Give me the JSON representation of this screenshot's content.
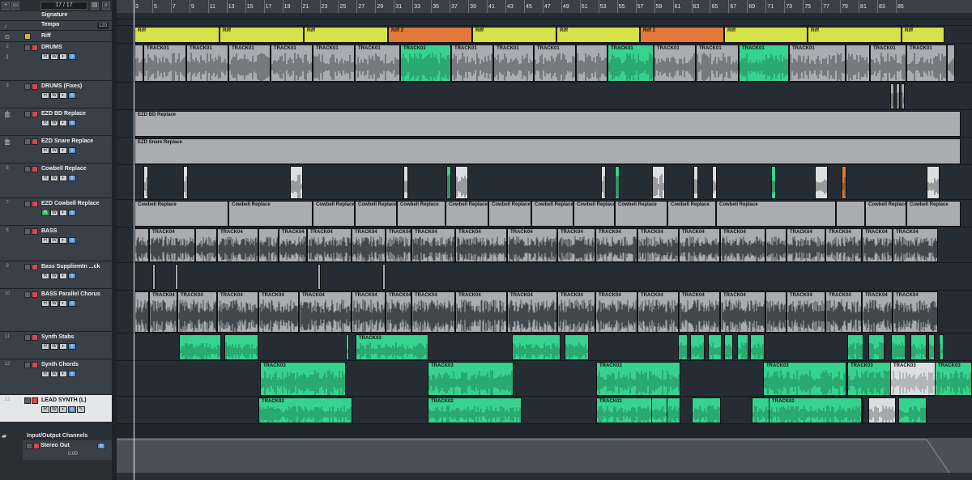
{
  "toolbar": {
    "track_counter": "17 / 17"
  },
  "ruler": {
    "bars": [
      "3",
      "5",
      "7",
      "9",
      "11",
      "13",
      "15",
      "17",
      "19",
      "21",
      "23",
      "25",
      "27",
      "29",
      "31",
      "33",
      "35",
      "37",
      "39",
      "41",
      "43",
      "45",
      "47",
      "49",
      "51",
      "53",
      "55",
      "57",
      "59",
      "61",
      "63",
      "65",
      "67",
      "69",
      "71",
      "73",
      "75",
      "77",
      "79",
      "81",
      "83",
      "85"
    ]
  },
  "tracks": [
    {
      "num": "",
      "name": "Signature",
      "icon": "signature-icon"
    },
    {
      "num": "",
      "name": "Tempo",
      "icon": "tempo-icon",
      "value": "120"
    },
    {
      "num": "",
      "name": "Riff",
      "icon": "marker-icon"
    },
    {
      "num": "2",
      "name": "DRUMS"
    },
    {
      "num": "3",
      "name": "DRUMS (Fixes)"
    },
    {
      "num": "4",
      "name": "EZD BD Replace"
    },
    {
      "num": "5",
      "name": "EZD Snare Replace"
    },
    {
      "num": "6",
      "name": "Cowbell Replace"
    },
    {
      "num": "7",
      "name": "EZD Cowbell Replace"
    },
    {
      "num": "8",
      "name": "BASS"
    },
    {
      "num": "9",
      "name": "Bass Supplie​mtn ...ck"
    },
    {
      "num": "10",
      "name": "BASS Parallel Chorus"
    },
    {
      "num": "11",
      "name": "Synth Stabs"
    },
    {
      "num": "12",
      "name": "Synth Chords"
    },
    {
      "num": "13",
      "name": "LEAD SYNTH (L)"
    }
  ],
  "io": {
    "folder": "Input/Output Channels",
    "stereo_out": "Stereo Out",
    "level": "0.00"
  },
  "parts": {
    "riff_labels": [
      "Riff",
      "Riff",
      "Riff",
      "Riff 2",
      "Riff",
      "Riff",
      "Riff 2",
      "Riff",
      "Riff",
      "Riff"
    ],
    "drum_label": "TRACK01",
    "bd_label": "EZD BD Replace",
    "snare_label": "EZD Snare Replace",
    "cowbell_label": "Cowbell Replace",
    "bass_label": "TRACK04",
    "synth_stab_label": "TRACK03",
    "synth_chord_label": "TRACK03",
    "lead_label": "TRACK02"
  }
}
